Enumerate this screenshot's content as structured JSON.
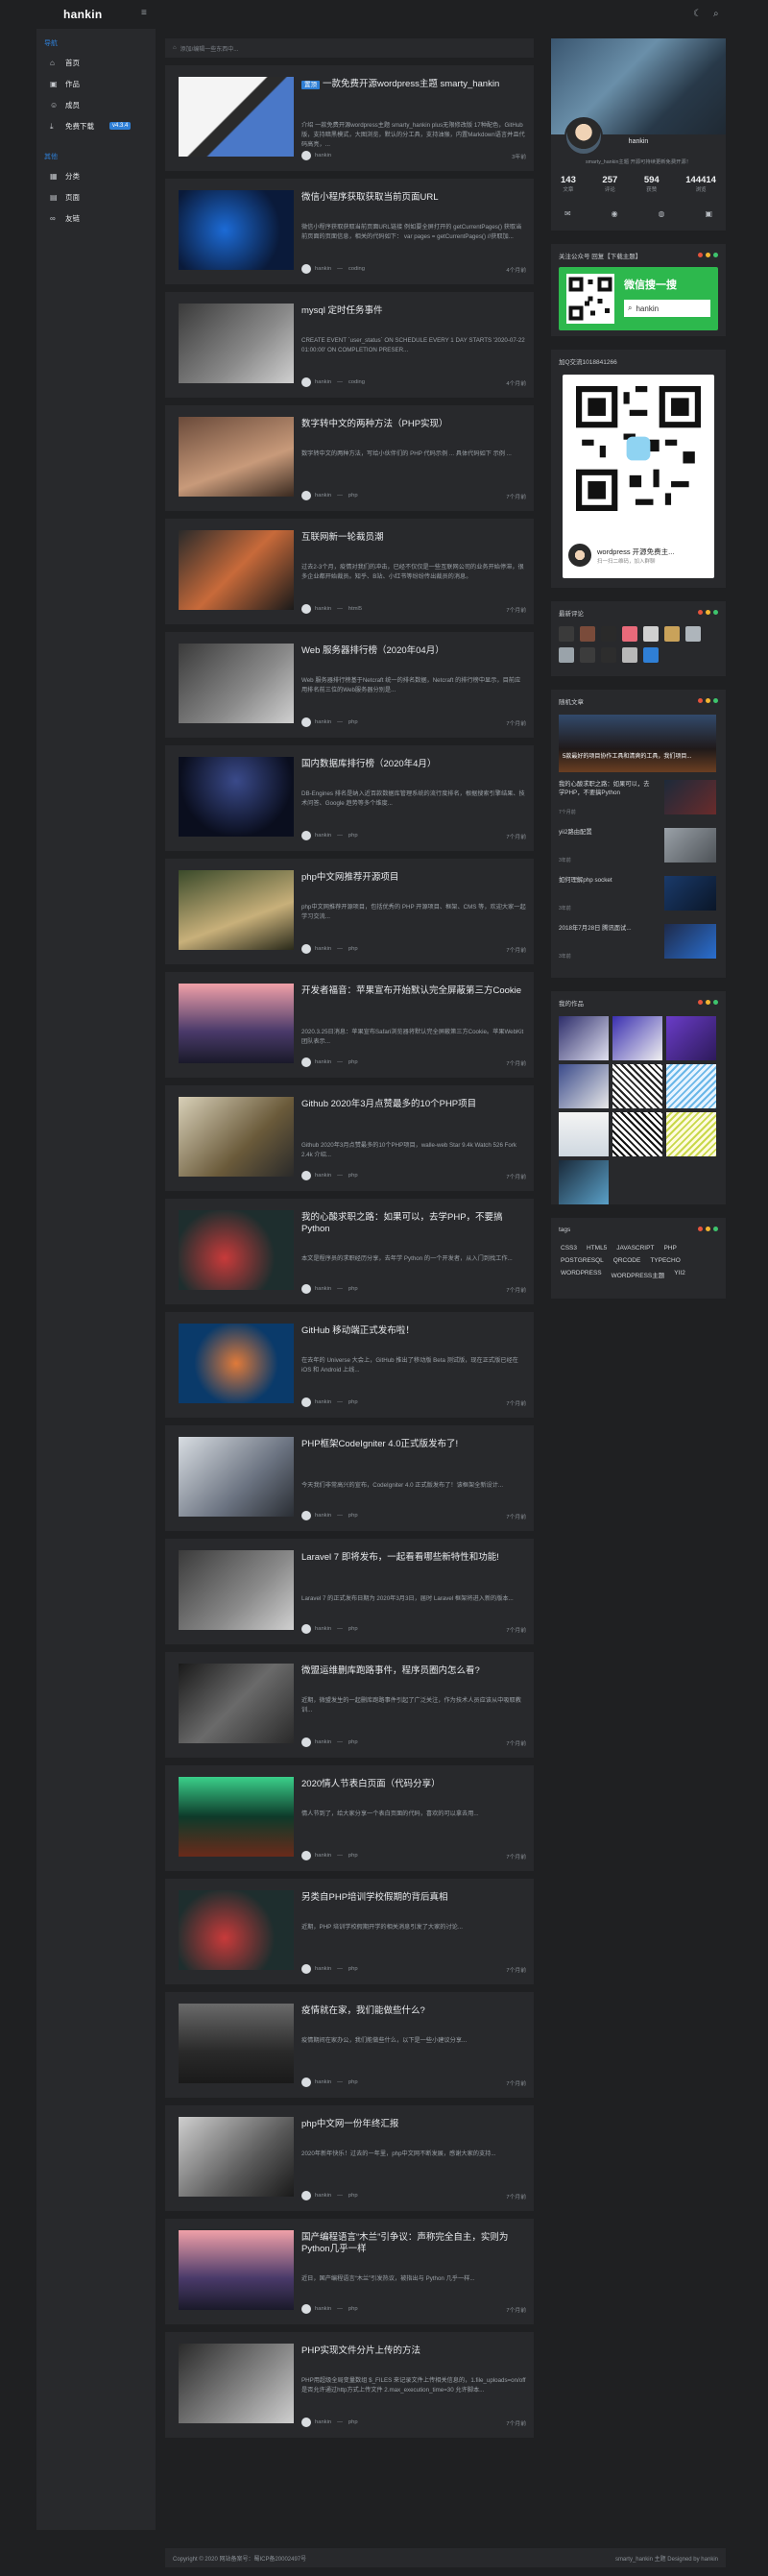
{
  "header": {
    "logo": "hankin"
  },
  "sidebar": {
    "group1": "导航",
    "group2": "其他",
    "items": [
      {
        "label": "首页",
        "icon": "home-icon"
      },
      {
        "label": "作品",
        "icon": "image-icon"
      },
      {
        "label": "成员",
        "icon": "users-icon"
      },
      {
        "label": "免费下载",
        "icon": "download-icon",
        "badge": "v4.3.4"
      }
    ],
    "items2": [
      {
        "label": "分类",
        "icon": "grid-icon"
      },
      {
        "label": "页面",
        "icon": "page-icon"
      },
      {
        "label": "友链",
        "icon": "link-icon"
      }
    ]
  },
  "breadcrumb": "添加/编辑一些东西中...",
  "posts": [
    {
      "title": "一款免费开源wordpress主题 smarty_hankin",
      "tag": "置顶",
      "excerpt": "介绍 一款免费开源wordpress主题 smarty_hankin plus无限修改版 17种配色，GitHub版，支持暗黑模式，大图浏览，默认的分工具，支持油猴，内置Markdown语言并且代码高亮，...",
      "author": "hankin",
      "cat": "",
      "date": "3年前"
    },
    {
      "title": "微信小程序获取获取当前页面URL",
      "excerpt": "微信小程序获取获取当前页面URL链接 例如要全屏打开的 getCurrentPages() 获取当前页面的页面信息，相关的代码如下： var pages = getCurrentPages() //获取加...",
      "author": "hankin",
      "cat": "coding",
      "date": "4个月前"
    },
    {
      "title": "mysql 定时任务事件",
      "excerpt": "CREATE EVENT `user_status` ON SCHEDULE EVERY 1 DAY STARTS '2020-07-22 01:00:00' ON COMPLETION PRESER...",
      "author": "hankin",
      "cat": "coding",
      "date": "4个月前"
    },
    {
      "title": "数字转中文的两种方法（PHP实现）",
      "excerpt": "数字转中文的两种方法，写给小伙伴们的 PHP 代码示例 ... 具体代码如下 示例 ...",
      "author": "hankin",
      "cat": "php",
      "date": "7个月前"
    },
    {
      "title": "互联网新一轮裁员潮",
      "excerpt": "过去2-3个月，疫情对我们的冲击，已经不仅仅是一些互联网公司的业务开始停滞，很多企业都开始裁员。知乎、B站、小红书等纷纷传出裁员的消息。",
      "author": "hankin",
      "cat": "html5",
      "date": "7个月前"
    },
    {
      "title": "Web 服务器排行榜（2020年04月）",
      "excerpt": "Web 服务器排行榜基于Netcraft 统一的排名数据，Netcraft 的排行榜中显示，目前应用排名前三位的Web服务器分别是...",
      "author": "hankin",
      "cat": "php",
      "date": "7个月前"
    },
    {
      "title": "国内数据库排行榜（2020年4月）",
      "excerpt": "DB-Engines 排名是纳入近百款数据库管理系统的流行度排名，根据搜索引擎结果、技术问答、Google 趋势等多个维度...",
      "author": "hankin",
      "cat": "php",
      "date": "7个月前"
    },
    {
      "title": "php中文网推荐开源项目",
      "excerpt": "php中文网推荐开源项目，包括优秀的 PHP 开源项目、框架、CMS 等，欢迎大家一起学习交流...",
      "author": "hankin",
      "cat": "php",
      "date": "7个月前"
    },
    {
      "title": "开发者福音：苹果宣布开始默认完全屏蔽第三方Cookie",
      "excerpt": "2020.3.25日消息：苹果宣布Safari浏览器将默认完全屏蔽第三方Cookie。苹果WebKit 团队表示...",
      "author": "hankin",
      "cat": "php",
      "date": "7个月前"
    },
    {
      "title": "Github 2020年3月点赞最多的10个PHP项目",
      "excerpt": "Github 2020年3月点赞最多的10个PHP项目，walle-web Star 9.4k Watch 526 Fork 2.4k 介绍...",
      "author": "hankin",
      "cat": "php",
      "date": "7个月前"
    },
    {
      "title": "我的心酸求职之路：如果可以，去学PHP，不要搞Python",
      "excerpt": "本文是程序员的求职经历分享，去年学 Python 的一个开发者，从入门到找工作...",
      "author": "hankin",
      "cat": "php",
      "date": "7个月前"
    },
    {
      "title": "GitHub 移动端正式发布啦！",
      "excerpt": "在去年的 Universe 大会上，GitHub 推出了移动版 Beta 测试版，现在正式版已经在 iOS 和 Android 上线...",
      "author": "hankin",
      "cat": "php",
      "date": "7个月前"
    },
    {
      "title": "PHP框架CodeIgniter 4.0正式版发布了!",
      "excerpt": "今天我们非常高兴的宣布，CodeIgniter 4.0 正式版发布了！该框架全新设计...",
      "author": "hankin",
      "cat": "php",
      "date": "7个月前"
    },
    {
      "title": "Laravel 7 即将发布，一起看看哪些新特性和功能!",
      "excerpt": "Laravel 7 的正式发布日期为 2020年3月3日，届时 Laravel 框架将进入新的版本...",
      "author": "hankin",
      "cat": "php",
      "date": "7个月前"
    },
    {
      "title": "微盟运维删库跑路事件，程序员圈内怎么看?",
      "excerpt": "近期，微盟发生的一起删库跑路事件引起了广泛关注，作为技术人员应该从中吸取教训...",
      "author": "hankin",
      "cat": "php",
      "date": "7个月前"
    },
    {
      "title": "2020情人节表白页面（代码分享）",
      "excerpt": "情人节到了，给大家分享一个表白页面的代码，喜欢的可以拿去用...",
      "author": "hankin",
      "cat": "php",
      "date": "7个月前"
    },
    {
      "title": "另类自PHP培训学校假期的背后真相",
      "excerpt": "近期，PHP 培训学校假期开学的相关消息引发了大家的讨论...",
      "author": "hankin",
      "cat": "php",
      "date": "7个月前"
    },
    {
      "title": "疫情就在家，我们能做些什么?",
      "excerpt": "疫情期间在家办公，我们能做些什么，以下是一些小建议分享...",
      "author": "hankin",
      "cat": "php",
      "date": "7个月前"
    },
    {
      "title": "php中文网一份年终汇报",
      "excerpt": "2020年新年快乐！过去的一年里，php中文网不断发展，感谢大家的支持...",
      "author": "hankin",
      "cat": "php",
      "date": "7个月前"
    },
    {
      "title": "国产编程语言“木兰”引争议：声称完全自主，实则为Python几乎一样",
      "excerpt": "近日，国产编程语言“木兰”引发热议，被指出与 Python 几乎一样...",
      "author": "hankin",
      "cat": "php",
      "date": "7个月前"
    },
    {
      "title": "PHP实现文件分片上传的方法",
      "excerpt": "PHP用超级全局变量数组 $_FILES 来记录文件上传相关信息的，1.file_uploads=on/off 是否允许通过http方式上传文件 2.max_execution_time=30 允许脚本...",
      "author": "hankin",
      "cat": "php",
      "date": "7个月前"
    }
  ],
  "profile": {
    "name": "hankin",
    "desc": "smarty_hankin主题 开源可持续更新免费开源！",
    "stats": [
      {
        "num": "143",
        "label": "文章"
      },
      {
        "num": "257",
        "label": "评论"
      },
      {
        "num": "594",
        "label": "获赞"
      },
      {
        "num": "144414",
        "label": "浏览"
      }
    ]
  },
  "wechat_search": {
    "title": "关注公众号 回复【下载主题】",
    "brand": "微信搜一搜",
    "keyword": "hankin"
  },
  "wxqr": {
    "title": "加Q交流1018841266",
    "name": "wordpress 开源免费主...",
    "sub": "扫一扫二维码，加入群聊"
  },
  "commenters": {
    "title": "最新评论"
  },
  "recent": {
    "title": "随机文章",
    "feature": "5款最好的项目协作工具和清爽的工具，我们项目...",
    "items": [
      {
        "title": "我的心酸求职之路：如果可以，去学PHP，不要搞Python",
        "date": "7个月前"
      },
      {
        "title": "yii2路由配置",
        "date": "3年前"
      },
      {
        "title": "如何理解php socket",
        "date": "3年前"
      },
      {
        "title": "2018年7月28日 腾讯面试...",
        "date": "3年前"
      }
    ]
  },
  "works": {
    "title": "我的作品"
  },
  "tags": {
    "title": "tags",
    "list": [
      "CSS3",
      "HTML5",
      "JAVASCRIPT",
      "PHP",
      "POSTGRESQL",
      "QRCODE",
      "TYPECHO",
      "WORDPRESS",
      "WORDPRESS主题",
      "YII2"
    ]
  },
  "footer": {
    "left": "Copyright © 2020 网站备案号：蜀ICP备20002497号",
    "right": "smarty_hankin 主题 Designed by hankin"
  },
  "colors": {
    "accent": "#2f7fd6",
    "wechat_green": "#2db84d",
    "dot_red": "#e5533c",
    "dot_yellow": "#f2b531",
    "dot_green": "#3ec46d"
  }
}
